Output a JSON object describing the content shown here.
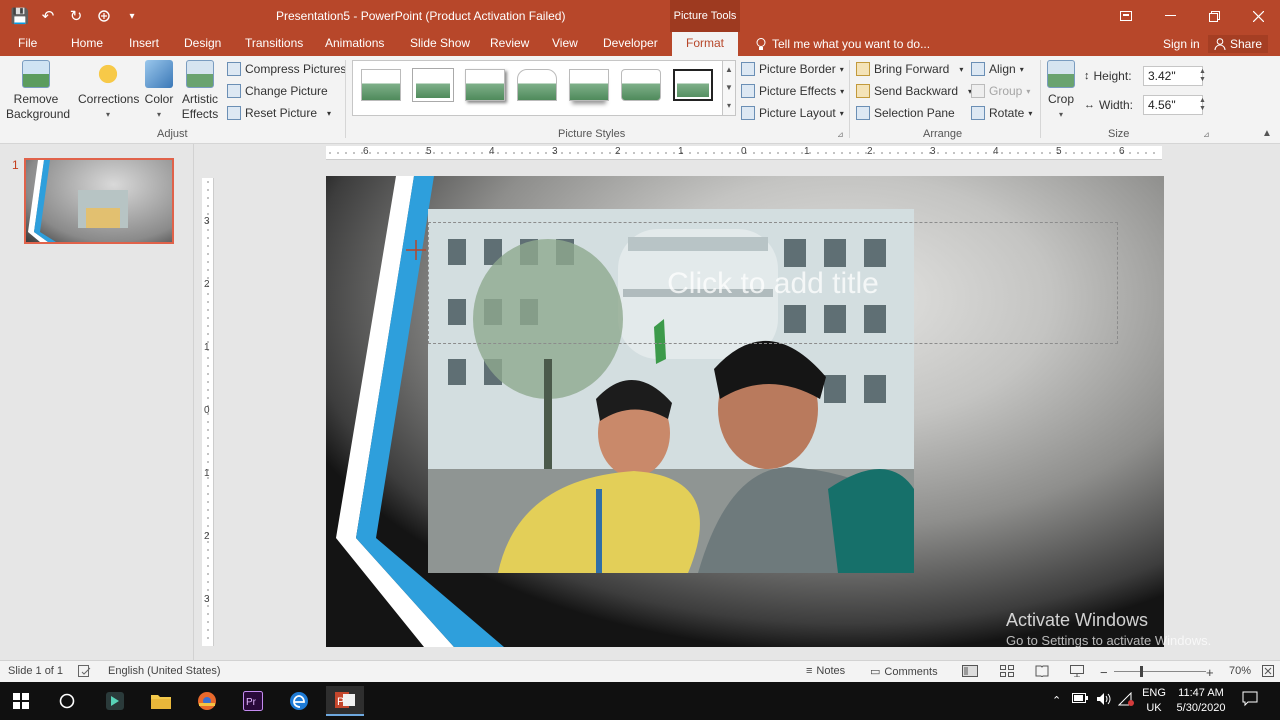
{
  "titlebar": {
    "title": "Presentation5 - PowerPoint (Product Activation Failed)",
    "context_tab": "Picture Tools",
    "qat_save": "💾",
    "qat_undo": "↶",
    "qat_redo": "↻",
    "qat_more": "▾"
  },
  "tabs": [
    "File",
    "Home",
    "Insert",
    "Design",
    "Transitions",
    "Animations",
    "Slide Show",
    "Review",
    "View",
    "Developer",
    "Format"
  ],
  "tell_me": "Tell me what you want to do...",
  "sign_in": "Sign in",
  "share": "Share",
  "ribbon": {
    "adjust": {
      "remove_bg_1": "Remove",
      "remove_bg_2": "Background",
      "corrections": "Corrections",
      "color": "Color",
      "artistic_1": "Artistic",
      "artistic_2": "Effects",
      "compress": "Compress Pictures",
      "change": "Change Picture",
      "reset": "Reset Picture",
      "label": "Adjust"
    },
    "styles": {
      "label": "Picture Styles"
    },
    "picture_border": "Picture Border",
    "picture_effects": "Picture Effects",
    "picture_layout": "Picture Layout",
    "arrange": {
      "bring_forward": "Bring Forward",
      "send_backward": "Send Backward",
      "selection_pane": "Selection Pane",
      "align": "Align",
      "group": "Group",
      "rotate": "Rotate",
      "label": "Arrange"
    },
    "size": {
      "crop": "Crop",
      "height_label": "Height:",
      "height_value": "3.42\"",
      "width_label": "Width:",
      "width_value": "4.56\"",
      "label": "Size"
    }
  },
  "thumbs": {
    "slide_number": "1"
  },
  "hruler_numbers": [
    "6",
    "5",
    "4",
    "3",
    "2",
    "1",
    "0",
    "1",
    "2",
    "3",
    "4",
    "5",
    "6"
  ],
  "vruler_numbers": [
    "3",
    "2",
    "1",
    "0",
    "1",
    "2",
    "3"
  ],
  "slide": {
    "title_placeholder": "Click to add title",
    "activate_1": "Activate Windows",
    "activate_2": "Go to Settings to activate Windows."
  },
  "status": {
    "slide": "Slide 1 of 1",
    "language": "English (United States)",
    "notes": "Notes",
    "comments": "Comments",
    "zoom": "70%"
  },
  "taskbar": {
    "lang_1": "ENG",
    "lang_2": "UK",
    "time": "11:47 AM",
    "date": "5/30/2020"
  },
  "colors": {
    "accent": "#b7472a",
    "stripe_blue": "#2e9fdc",
    "thumb_border": "#e0624a"
  }
}
